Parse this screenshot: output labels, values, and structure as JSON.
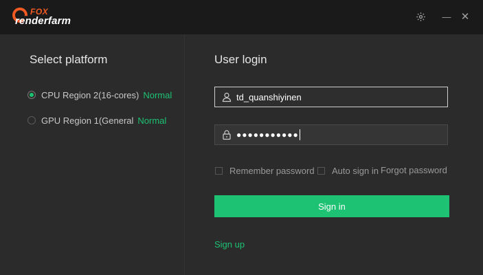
{
  "app": {
    "logo_top": "FOX",
    "logo_bottom": "renderfarm"
  },
  "window_controls": {
    "settings_icon": "gear-icon",
    "minimize_symbol": "—",
    "close_symbol": "✕"
  },
  "platform": {
    "title": "Select platform",
    "items": [
      {
        "name": "CPU Region 2(16-cores)",
        "status": "Normal",
        "selected": true
      },
      {
        "name": "GPU Region 1(General",
        "status": "Normal",
        "selected": false
      }
    ]
  },
  "login": {
    "title": "User login",
    "username_value": "td_quanshiyinen",
    "password_mask": "●●●●●●●●●●●",
    "remember_label": "Remember password",
    "auto_signin_label": "Auto sign in",
    "forgot_label": "Forgot password",
    "signin_label": "Sign in",
    "signup_label": "Sign up"
  },
  "colors": {
    "accent": "#1dc273",
    "brand_orange": "#f25a24",
    "titlebar_bg": "#1a1a1a",
    "panel_bg": "#2b2b2b"
  }
}
